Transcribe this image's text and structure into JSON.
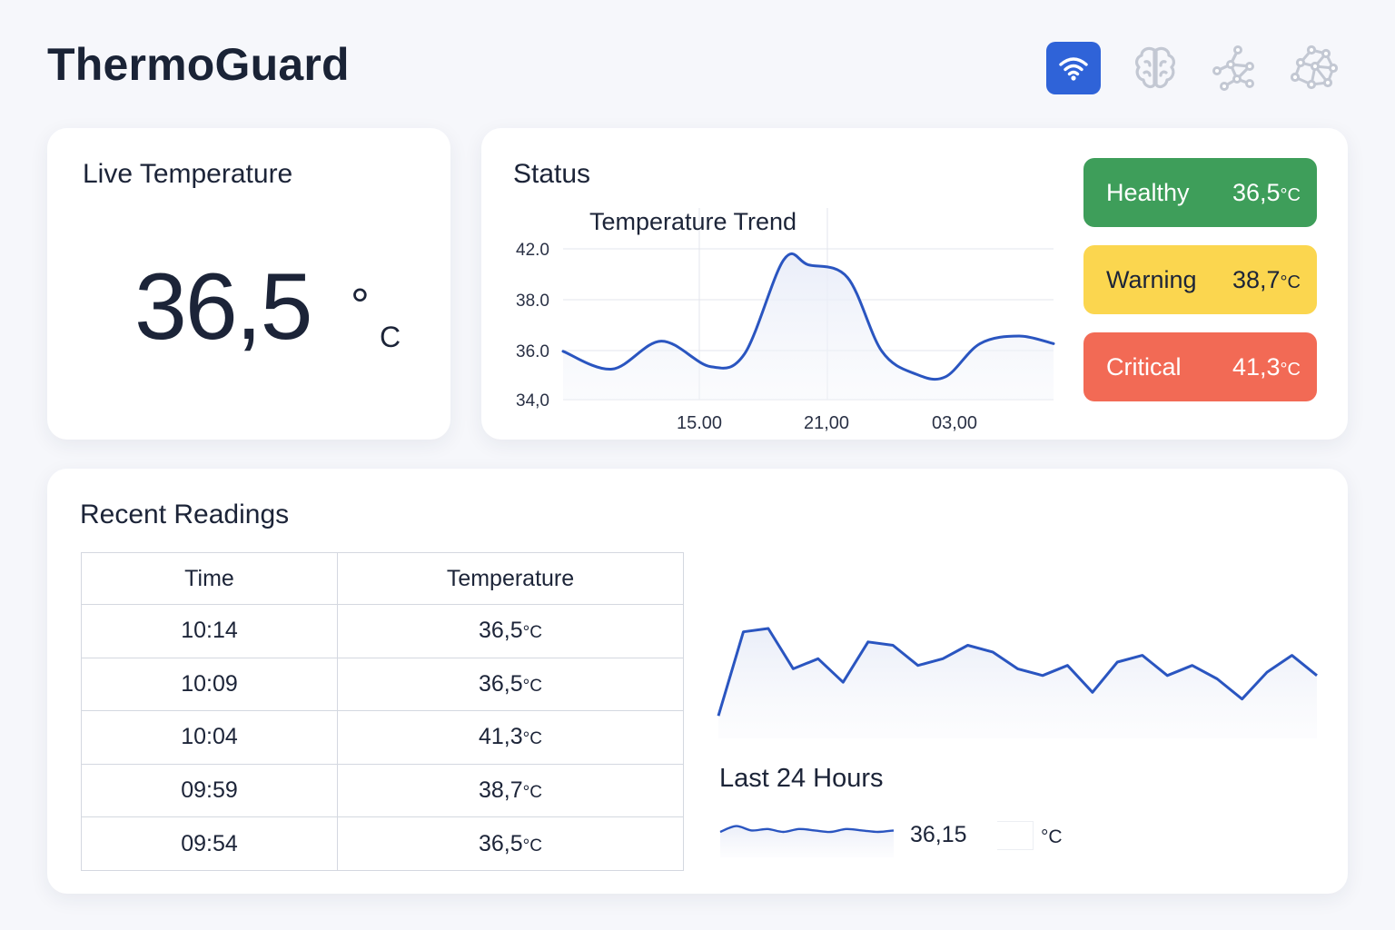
{
  "app": {
    "title": "ThermoGuard"
  },
  "toolbar": {
    "buttons": [
      {
        "icon": "wifi-icon",
        "active": true
      },
      {
        "icon": "brain-icon",
        "active": false
      },
      {
        "icon": "graph-nodes-icon",
        "active": false
      },
      {
        "icon": "molecule-icon",
        "active": false
      }
    ]
  },
  "live": {
    "title": "Live Temperature",
    "value": "36,5",
    "degree": "°",
    "unit": "C"
  },
  "status": {
    "title": "Status",
    "badges": [
      {
        "label": "Healthy",
        "value": "36,5",
        "unit": "°C",
        "color": "#3e9e5a"
      },
      {
        "label": "Warning",
        "value": "38,7",
        "unit": "°C",
        "color": "#fbd64f"
      },
      {
        "label": "Critical",
        "value": "41,3",
        "unit": "°C",
        "color": "#f26a55"
      }
    ]
  },
  "chart_data": [
    {
      "type": "line",
      "title": "Temperature Trend",
      "y_tick_labels": [
        "42.0",
        "38.0",
        "36.0",
        "34,0"
      ],
      "x_tick_labels": [
        "15.00",
        "21,00",
        "03,00"
      ],
      "grid": true,
      "series": [
        {
          "color": "#2a55c0",
          "points": [
            [
              0.0,
              35.9
            ],
            [
              0.1,
              35.2
            ],
            [
              0.2,
              36.3
            ],
            [
              0.3,
              35.3
            ],
            [
              0.37,
              35.8
            ],
            [
              0.45,
              39.5
            ],
            [
              0.5,
              39.3
            ],
            [
              0.58,
              38.8
            ],
            [
              0.65,
              35.9
            ],
            [
              0.72,
              35.0
            ],
            [
              0.78,
              34.9
            ],
            [
              0.85,
              36.2
            ],
            [
              0.93,
              36.5
            ],
            [
              1.0,
              36.2
            ]
          ]
        }
      ]
    },
    {
      "type": "area",
      "title": "Last 24 Hours",
      "series": [
        {
          "color": "#2a55c0",
          "values": [
            34.4,
            36.9,
            37.0,
            35.8,
            36.1,
            35.4,
            36.6,
            36.5,
            35.9,
            36.1,
            36.5,
            36.3,
            35.8,
            35.6,
            35.9,
            35.1,
            36.0,
            36.2,
            35.6,
            35.9,
            35.5,
            34.9,
            35.7,
            36.2,
            35.6
          ]
        }
      ]
    },
    {
      "type": "line",
      "title": "",
      "series": [
        {
          "color": "#2a55c0",
          "values": [
            36.0,
            36.4,
            36.1,
            36.2,
            36.0,
            36.2,
            36.1,
            36.0,
            36.2,
            36.1,
            36.0,
            36.1
          ]
        }
      ]
    }
  ],
  "recent": {
    "title": "Recent Readings",
    "columns": [
      "Time",
      "Temperature"
    ],
    "rows": [
      {
        "time": "10:14",
        "temp": "36,5",
        "unit": "°C"
      },
      {
        "time": "10:09",
        "temp": "36,5",
        "unit": "°C"
      },
      {
        "time": "10:04",
        "temp": "41,3",
        "unit": "°C"
      },
      {
        "time": "09:59",
        "temp": "38,7",
        "unit": "°C"
      },
      {
        "time": "09:54",
        "temp": "36,5",
        "unit": "°C"
      }
    ]
  },
  "last24": {
    "label": "Last 24 Hours",
    "value": "36,15",
    "unit": "°C"
  }
}
